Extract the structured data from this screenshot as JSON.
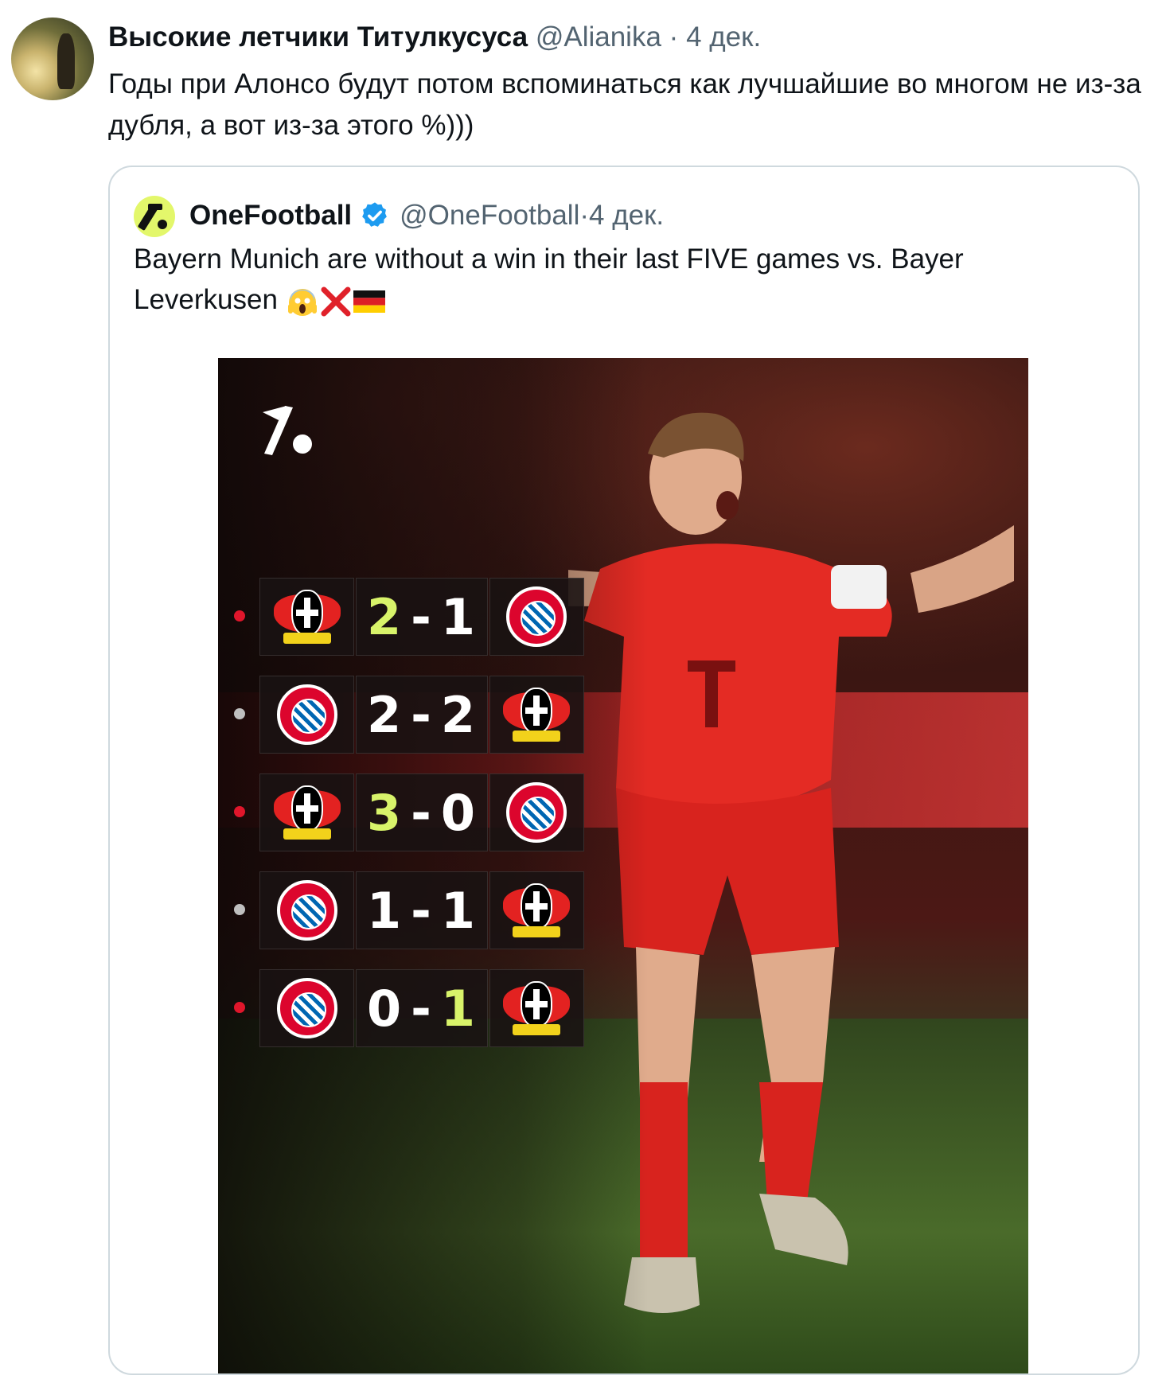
{
  "tweet": {
    "author_name": "Высокие летчики Титулкусуса",
    "handle": "@Alianika",
    "separator": "·",
    "date": "4 дек.",
    "text": "Годы при Алонсо будут потом вспоминаться как лучшайшие во многом не из-за дубля, а вот из-за этого %)))"
  },
  "quoted": {
    "author_name": "OneFootball",
    "handle": "@OneFootball",
    "separator": "·",
    "date": "4 дек.",
    "text": "Bayern Munich are without a win in their last FIVE games vs. Bayer Leverkusen",
    "emojis": [
      "face-screaming-emoji",
      "cross-mark-emoji",
      "germany-flag-emoji"
    ],
    "media": {
      "brand_icon": "onefootball-logo",
      "results": [
        {
          "home": "Leverkusen",
          "home_goals": "2",
          "dash": "-",
          "away_goals": "1",
          "away": "Bayern",
          "highlight": "home",
          "dot_color": "#e0162b"
        },
        {
          "home": "Bayern",
          "home_goals": "2",
          "dash": "-",
          "away_goals": "2",
          "away": "Leverkusen",
          "highlight": "none",
          "dot_color": "#bfbfbf"
        },
        {
          "home": "Leverkusen",
          "home_goals": "3",
          "dash": "-",
          "away_goals": "0",
          "away": "Bayern",
          "highlight": "home",
          "dot_color": "#e0162b"
        },
        {
          "home": "Bayern",
          "home_goals": "1",
          "dash": "-",
          "away_goals": "1",
          "away": "Leverkusen",
          "highlight": "none",
          "dot_color": "#bfbfbf"
        },
        {
          "home": "Bayern",
          "home_goals": "0",
          "dash": "-",
          "away_goals": "1",
          "away": "Leverkusen",
          "highlight": "away",
          "dot_color": "#e0162b"
        }
      ],
      "accent_color": "#d8f36a"
    }
  }
}
